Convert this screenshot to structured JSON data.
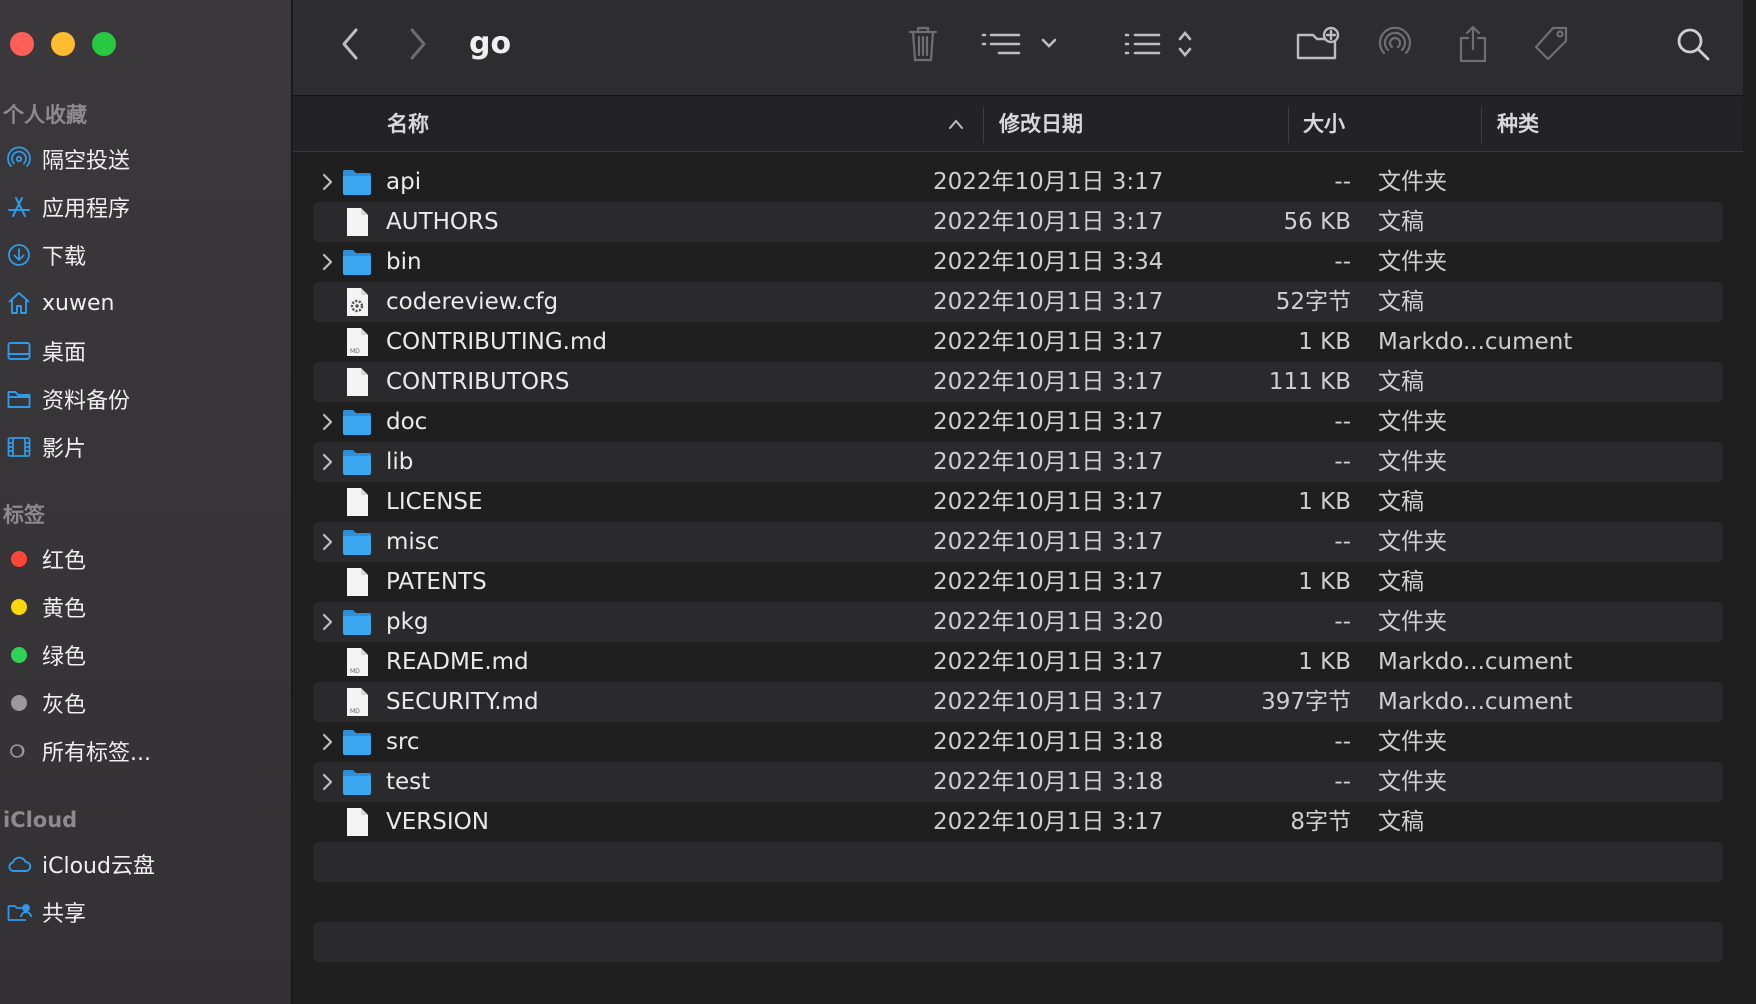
{
  "window": {
    "title": "go"
  },
  "sidebar": {
    "favorites_heading": "个人收藏",
    "favorites": [
      {
        "label": "隔空投送",
        "icon": "airdrop-icon"
      },
      {
        "label": "应用程序",
        "icon": "applications-icon"
      },
      {
        "label": "下载",
        "icon": "download-icon"
      },
      {
        "label": "xuwen",
        "icon": "home-icon"
      },
      {
        "label": "桌面",
        "icon": "desktop-icon"
      },
      {
        "label": "资料备份",
        "icon": "folder-icon"
      },
      {
        "label": "影片",
        "icon": "film-icon"
      }
    ],
    "tags_heading": "标签",
    "tags": [
      {
        "label": "红色",
        "color": "#ff453a"
      },
      {
        "label": "黄色",
        "color": "#ffd60a"
      },
      {
        "label": "绿色",
        "color": "#30d158"
      },
      {
        "label": "灰色",
        "color": "#98989d"
      },
      {
        "label": "所有标签...",
        "color": ""
      }
    ],
    "icloud_heading": "iCloud",
    "icloud": [
      {
        "label": "iCloud云盘",
        "icon": "cloud-icon"
      },
      {
        "label": "共享",
        "icon": "shared-folder-icon"
      }
    ]
  },
  "columns": {
    "name": "名称",
    "date": "修改日期",
    "size": "大小",
    "kind": "种类"
  },
  "files": [
    {
      "name": "api",
      "date": "2022年10月1日 3:17",
      "size": "--",
      "kind": "文件夹",
      "type": "folder"
    },
    {
      "name": "AUTHORS",
      "date": "2022年10月1日 3:17",
      "size": "56 KB",
      "kind": "文稿",
      "type": "doc"
    },
    {
      "name": "bin",
      "date": "2022年10月1日 3:34",
      "size": "--",
      "kind": "文件夹",
      "type": "folder"
    },
    {
      "name": "codereview.cfg",
      "date": "2022年10月1日 3:17",
      "size": "52字节",
      "kind": "文稿",
      "type": "cfg"
    },
    {
      "name": "CONTRIBUTING.md",
      "date": "2022年10月1日 3:17",
      "size": "1 KB",
      "kind": "Markdo...cument",
      "type": "md"
    },
    {
      "name": "CONTRIBUTORS",
      "date": "2022年10月1日 3:17",
      "size": "111 KB",
      "kind": "文稿",
      "type": "doc"
    },
    {
      "name": "doc",
      "date": "2022年10月1日 3:17",
      "size": "--",
      "kind": "文件夹",
      "type": "folder"
    },
    {
      "name": "lib",
      "date": "2022年10月1日 3:17",
      "size": "--",
      "kind": "文件夹",
      "type": "folder"
    },
    {
      "name": "LICENSE",
      "date": "2022年10月1日 3:17",
      "size": "1 KB",
      "kind": "文稿",
      "type": "doc"
    },
    {
      "name": "misc",
      "date": "2022年10月1日 3:17",
      "size": "--",
      "kind": "文件夹",
      "type": "folder"
    },
    {
      "name": "PATENTS",
      "date": "2022年10月1日 3:17",
      "size": "1 KB",
      "kind": "文稿",
      "type": "doc"
    },
    {
      "name": "pkg",
      "date": "2022年10月1日 3:20",
      "size": "--",
      "kind": "文件夹",
      "type": "folder"
    },
    {
      "name": "README.md",
      "date": "2022年10月1日 3:17",
      "size": "1 KB",
      "kind": "Markdo...cument",
      "type": "md"
    },
    {
      "name": "SECURITY.md",
      "date": "2022年10月1日 3:17",
      "size": "397字节",
      "kind": "Markdo...cument",
      "type": "md"
    },
    {
      "name": "src",
      "date": "2022年10月1日 3:18",
      "size": "--",
      "kind": "文件夹",
      "type": "folder"
    },
    {
      "name": "test",
      "date": "2022年10月1日 3:18",
      "size": "--",
      "kind": "文件夹",
      "type": "folder"
    },
    {
      "name": "VERSION",
      "date": "2022年10月1日 3:17",
      "size": "8字节",
      "kind": "文稿",
      "type": "doc"
    }
  ],
  "colors": {
    "accent": "#2f9ae6",
    "folder": "#3aa7f0"
  }
}
